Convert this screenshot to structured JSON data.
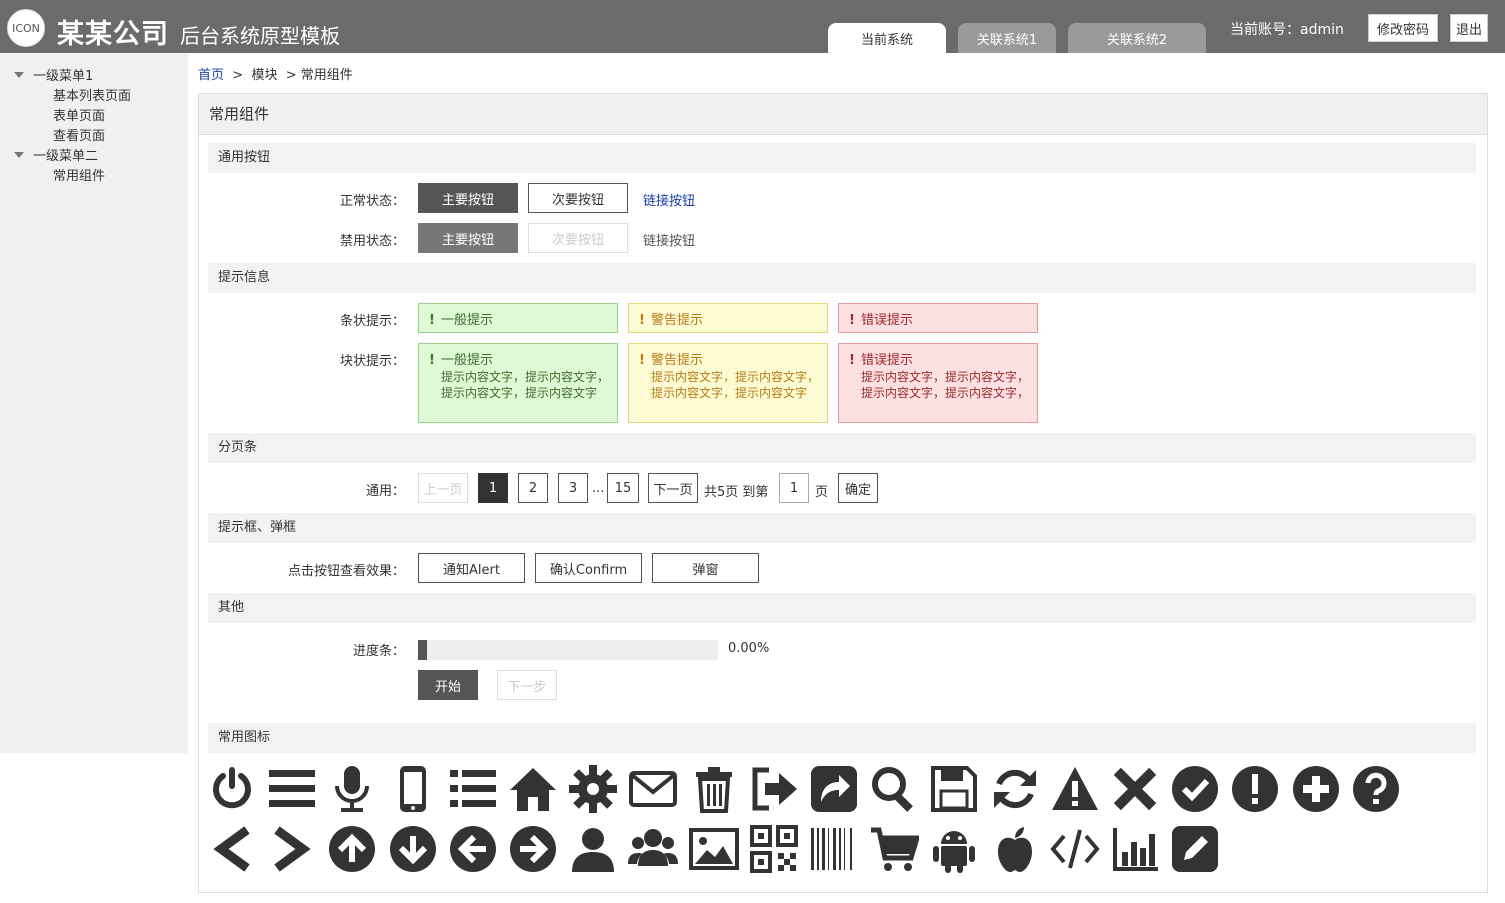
{
  "header": {
    "logo": "ICON",
    "company": "某某公司",
    "system_name": "后台系统原型模板",
    "tabs": [
      "当前系统",
      "关联系统1",
      "关联系统2"
    ],
    "account": "当前账号：admin",
    "change_password": "修改密码",
    "logout": "退出"
  },
  "sidebar": {
    "groups": [
      {
        "label": "一级菜单1",
        "items": [
          "基本列表页面",
          "表单页面",
          "查看页面"
        ]
      },
      {
        "label": "一级菜单二",
        "items": [
          "常用组件"
        ]
      }
    ]
  },
  "breadcrumb": {
    "home": "首页",
    "sep1": ">",
    "module": "模块",
    "sep2": ">",
    "current": "常用组件"
  },
  "panel": {
    "title": "常用组件"
  },
  "sections": {
    "buttons": "通用按钮",
    "alerts": "提示信息",
    "pagination": "分页条",
    "dialogs": "提示框、弹框",
    "other": "其他",
    "icons": "常用图标"
  },
  "buttons": {
    "normal_label": "正常状态：",
    "disabled_label": "禁用状态：",
    "primary": "主要按钮",
    "secondary": "次要按钮",
    "link": "链接按钮"
  },
  "alerts": {
    "bar_label": "条状提示：",
    "block_label": "块状提示：",
    "bang": "!",
    "info": "一般提示",
    "warning": "警告提示",
    "error": "错误提示",
    "body_line": "提示内容文字，提示内容文字，",
    "body_line2": "提示内容文字，提示内容文字",
    "body_line2_err": "提示内容文字，提示内容文字，"
  },
  "pagination": {
    "label": "通用：",
    "prev": "上一页",
    "pages": [
      "1",
      "2",
      "3"
    ],
    "ellipsis": "...",
    "last": "15",
    "next": "下一页",
    "total": "共5页 到第",
    "goto_value": "1",
    "page_unit": "页",
    "confirm": "确定"
  },
  "dialogs": {
    "label": "点击按钮查看效果：",
    "alert": "通知Alert",
    "confirm": "确认Confirm",
    "popup": "弹窗"
  },
  "other": {
    "progress_label": "进度条：",
    "progress_value": "0.00%",
    "progress_fraction": 0.03,
    "start": "开始",
    "next_step": "下一步"
  },
  "icons": {
    "row1": [
      "power-icon",
      "menu-icon",
      "microphone-icon",
      "mobile-icon",
      "list-icon",
      "home-icon",
      "gear-icon",
      "envelope-icon",
      "trash-icon",
      "sign-out-icon",
      "share-icon",
      "search-icon",
      "save-icon",
      "refresh-icon",
      "warning-icon",
      "close-icon",
      "check-circle-icon",
      "exclamation-circle-icon",
      "plus-circle-icon",
      "question-circle-icon"
    ],
    "row2": [
      "chevron-left-icon",
      "chevron-right-icon",
      "arrow-up-circle-icon",
      "arrow-down-circle-icon",
      "arrow-left-circle-icon",
      "arrow-right-circle-icon",
      "user-icon",
      "users-icon",
      "image-icon",
      "qrcode-icon",
      "barcode-icon",
      "cart-icon",
      "android-icon",
      "apple-icon",
      "code-icon",
      "bar-chart-icon",
      "edit-icon"
    ]
  },
  "colors": {
    "header": "#6b6b6b",
    "primary": "#555555",
    "link": "#1a3ea8"
  }
}
